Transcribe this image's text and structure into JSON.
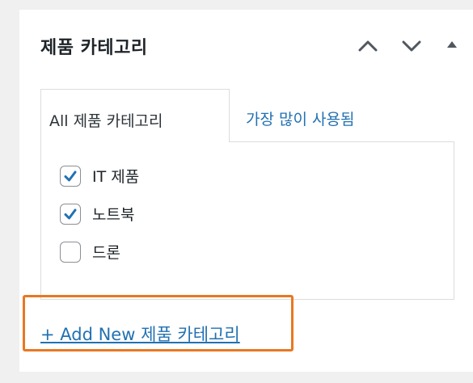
{
  "metabox": {
    "title": "제품 카테고리",
    "controls": [
      {
        "name": "move-up-icon"
      },
      {
        "name": "move-down-icon"
      },
      {
        "name": "toggle-panel-icon"
      }
    ]
  },
  "tabs": [
    {
      "label": "All 제품 카테고리",
      "active": true
    },
    {
      "label": "가장 많이 사용됨",
      "active": false
    }
  ],
  "categories": [
    {
      "label": "IT 제품",
      "checked": true
    },
    {
      "label": "노트북",
      "checked": true
    },
    {
      "label": "드론",
      "checked": false
    }
  ],
  "add_new": {
    "label": "+ Add New 제품 카테고리",
    "highlight_color": "#e87722"
  },
  "colors": {
    "link": "#2271b1",
    "checkmark": "#2271b1",
    "text": "#1d2327"
  }
}
